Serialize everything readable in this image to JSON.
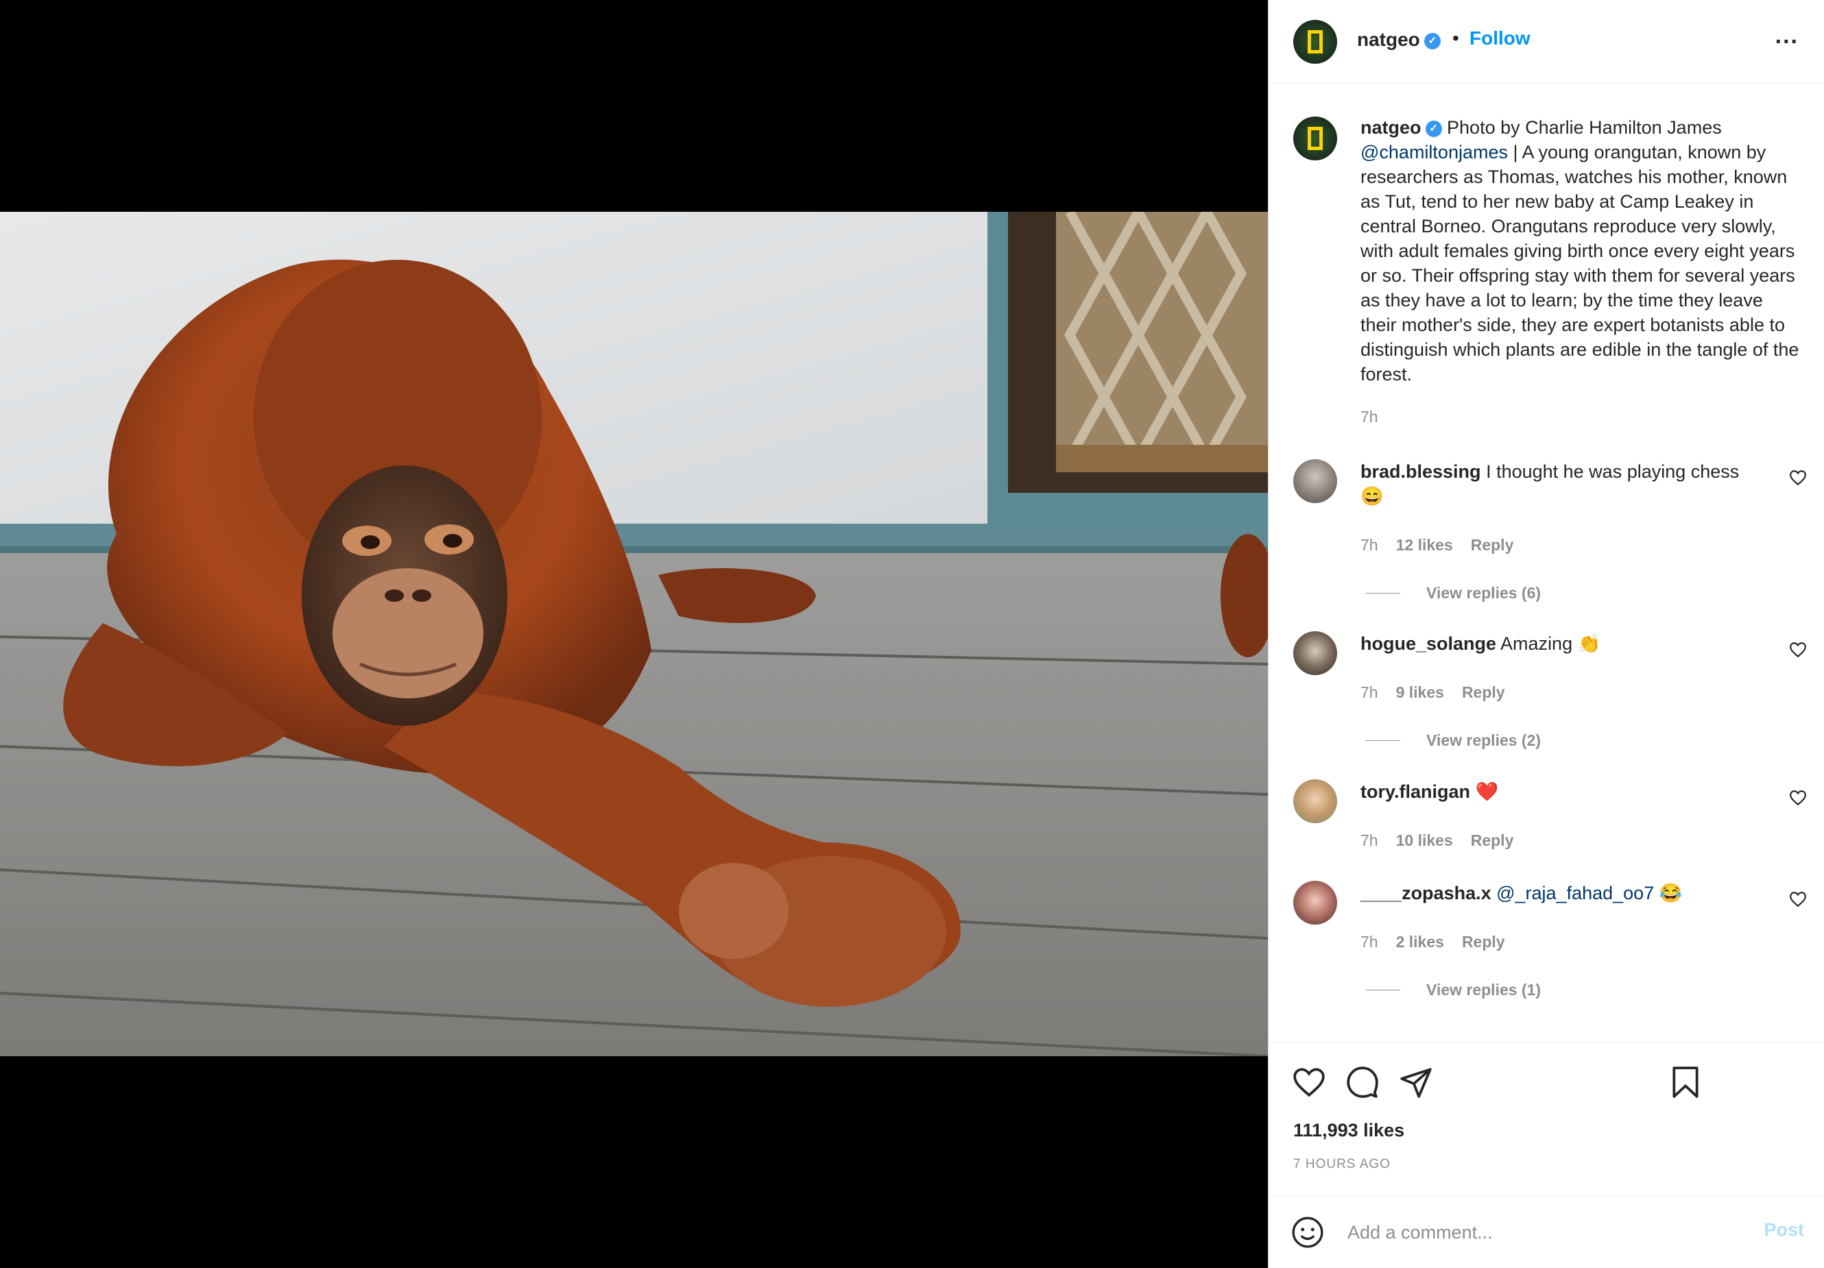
{
  "post": {
    "username": "natgeo",
    "follow_label": "Follow",
    "dot": "•",
    "more": "...",
    "caption_prefix": "Photo by Charlie Hamilton James",
    "caption_mention": "@chamiltonjames",
    "caption_body": " | A young orangutan, known by researchers as Thomas, watches his mother, known as Tut, tend to her new baby at Camp Leakey in central Borneo. Orangutans reproduce very slowly, with adult females giving birth once every eight years or so. Their offspring stay with them for several years as they have a lot to learn; by the time they leave their mother's side, they are expert botanists able to distinguish which plants are edible in the tangle of the forest.",
    "caption_time": "7h",
    "likes": "111,993 likes",
    "posted_ago": "7 HOURS AGO"
  },
  "comments": [
    {
      "username": "brad.blessing",
      "text": "I thought he was playing chess 😄",
      "mention": "",
      "time": "7h",
      "likes": "12 likes",
      "reply": "Reply",
      "view_replies": "View replies (6)"
    },
    {
      "username": "hogue_solange",
      "text": "Amazing 👏",
      "mention": "",
      "time": "7h",
      "likes": "9 likes",
      "reply": "Reply",
      "view_replies": "View replies (2)"
    },
    {
      "username": "tory.flanigan",
      "text": "❤️",
      "mention": "",
      "time": "7h",
      "likes": "10 likes",
      "reply": "Reply",
      "view_replies": ""
    },
    {
      "username": "____zopasha.x",
      "text": " 😂",
      "mention": "@_raja_fahad_oo7",
      "time": "7h",
      "likes": "2 likes",
      "reply": "Reply",
      "view_replies": "View replies (1)"
    }
  ],
  "composer": {
    "placeholder": "Add a comment...",
    "post_label": "Post"
  },
  "icons": {
    "emoji": "emoji-icon",
    "heart": "heart-icon",
    "comment": "comment-icon",
    "share": "share-icon",
    "save": "bookmark-icon"
  },
  "colors": {
    "follow": "#0095f6",
    "mention": "#00376b",
    "verified": "#3897f0",
    "muted": "#8e8e8e",
    "post_disabled": "#b2dffc"
  }
}
